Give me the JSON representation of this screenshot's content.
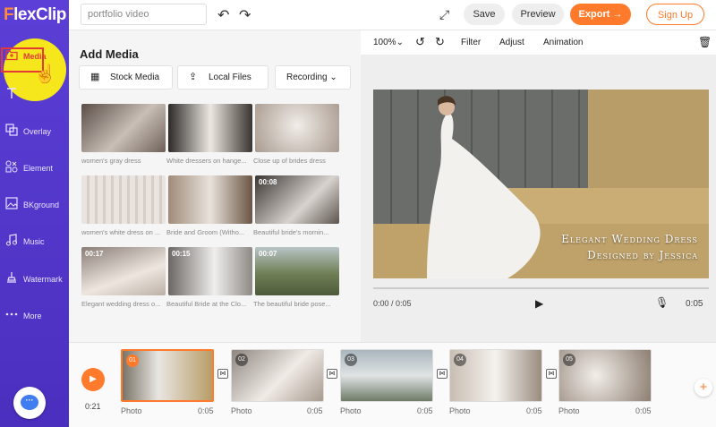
{
  "app": {
    "logo_prefix": "F",
    "logo_rest": "lexClip"
  },
  "sidebar": {
    "items": [
      {
        "label": "Media",
        "icon": "folder-plus-icon"
      },
      {
        "label": "Text",
        "icon": "text-t-icon"
      },
      {
        "label": "Overlay",
        "icon": "overlay-icon"
      },
      {
        "label": "Element",
        "icon": "element-icon"
      },
      {
        "label": "BKground",
        "icon": "background-icon"
      },
      {
        "label": "Music",
        "icon": "music-note-icon"
      },
      {
        "label": "Watermark",
        "icon": "watermark-icon"
      },
      {
        "label": "More",
        "icon": "more-dots-icon"
      }
    ]
  },
  "topbar": {
    "project_name": "portfolio video",
    "save": "Save",
    "preview": "Preview",
    "export": "Export →",
    "signup": "Sign Up"
  },
  "panel": {
    "title": "Add Media",
    "stock": "Stock Media",
    "local": "Local Files",
    "recording": "Recording ⌄",
    "media": [
      {
        "caption": "women's gray dress",
        "duration": ""
      },
      {
        "caption": "White dressers on hange...",
        "duration": ""
      },
      {
        "caption": "Close up of brides dress",
        "duration": ""
      },
      {
        "caption": "women's white dress on ...",
        "duration": ""
      },
      {
        "caption": "Bride and Groom (Witho...",
        "duration": ""
      },
      {
        "caption": "Beautiful bride's mornin...",
        "duration": "00:08"
      },
      {
        "caption": "Elegant wedding dress o...",
        "duration": "00:17"
      },
      {
        "caption": "Beautiful Bride at the Clo...",
        "duration": "00:15"
      },
      {
        "caption": "The beautiful bride pose...",
        "duration": "00:07"
      }
    ]
  },
  "preview": {
    "zoom": "100%⌄",
    "filter": "Filter",
    "adjust": "Adjust",
    "animation": "Animation",
    "caption_line1": "Elegant Wedding Dress",
    "caption_line2": "Designed by Jessica",
    "time_current": "0:00 / 0:05",
    "time_end": "0:05"
  },
  "timeline": {
    "time": "0:21",
    "clips": [
      {
        "num": "01",
        "type": "Photo",
        "duration": "0:05"
      },
      {
        "num": "02",
        "type": "Photo",
        "duration": "0:05"
      },
      {
        "num": "03",
        "type": "Photo",
        "duration": "0:05"
      },
      {
        "num": "04",
        "type": "Photo",
        "duration": "0:05"
      },
      {
        "num": "05",
        "type": "Photo",
        "duration": "0:05"
      }
    ]
  }
}
